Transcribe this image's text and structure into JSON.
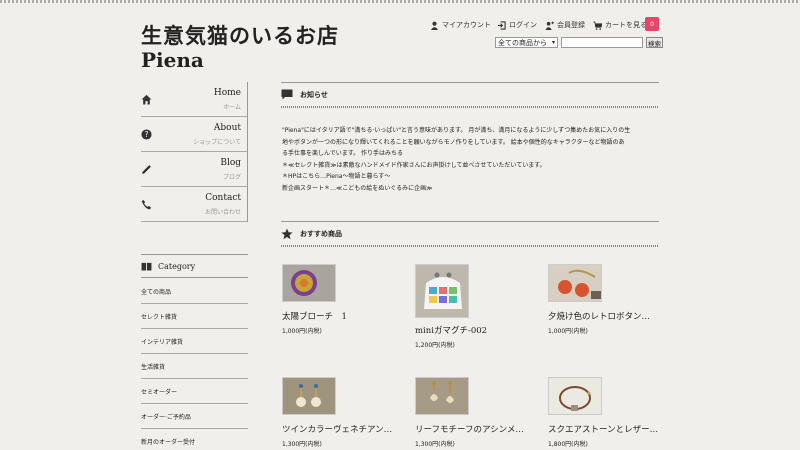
{
  "header": {
    "title": "生意気猫のいるお店",
    "subtitle": "Piena",
    "account": "マイアカウント",
    "login": "ログイン",
    "register": "会員登録",
    "cart": "カートを見る",
    "cart_count": "0",
    "search_select": "全ての商品から",
    "search_button": "検索"
  },
  "nav": [
    {
      "en": "Home",
      "jp": "ホーム"
    },
    {
      "en": "About",
      "jp": "ショップについて"
    },
    {
      "en": "Blog",
      "jp": "ブログ"
    },
    {
      "en": "Contact",
      "jp": "お問い合わせ"
    }
  ],
  "category": {
    "heading": "Category",
    "items": [
      "全ての商品",
      "セレクト雑貨",
      "インテリア雑貨",
      "生活雑貨",
      "セミオーダー",
      "オーダー·ご予約品",
      "新月のオーダー受付"
    ]
  },
  "notice": {
    "heading": "お知らせ",
    "lines": [
      "\"Piena\"にはイタリア語で\"満ちる·いっぱい\"と言う意味があります。 月が満ち、満月になるように少しずつ集めたお気に入りの生",
      "地やボタンが一つの形になり輝いてくれることを願いながらモノ作りをしています。 絵本や個性的なキャラクターなど物語のあ",
      "る手仕事を楽しんでいます。 作り手はみちる",
      "＊≪セレクト雑貨≫は素敵なハンドメイド作家さんにお声掛けして並べさせていただいています。",
      "＊HPはこちら…Piena～物語と暮らす～",
      "新企画スタート＊…≪こどもの絵をぬいぐるみに企画≫"
    ]
  },
  "products": {
    "heading": "おすすめ商品",
    "items": [
      {
        "name": "太陽ブローチ　1",
        "price": "1,000円(内税)"
      },
      {
        "name": "miniガマグチ-002",
        "price": "1,200円(内税)"
      },
      {
        "name": "夕焼け色のレトロボタン…",
        "price": "1,000円(内税)"
      },
      {
        "name": "ツインカラーヴェネチアン…",
        "price": "1,300円(内税)"
      },
      {
        "name": "リーフモチーフのアシンメ…",
        "price": "1,300円(内税)"
      },
      {
        "name": "スクエアストーンとレザー…",
        "price": "1,800円(内税)"
      }
    ]
  },
  "colors": {
    "badge": "#e84463",
    "background": "#f1efeb"
  }
}
